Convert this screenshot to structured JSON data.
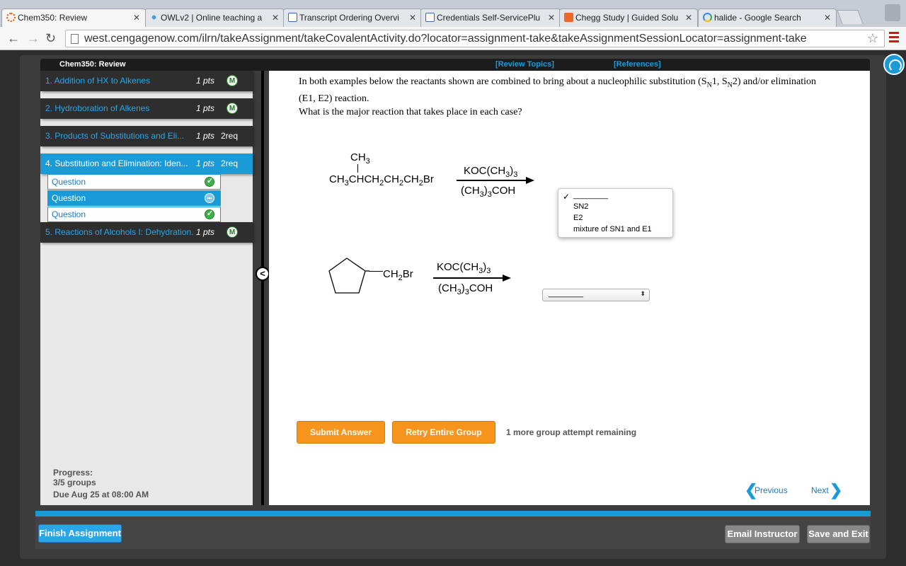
{
  "browser": {
    "tabs": [
      {
        "title": "Chem350: Review",
        "favicon": "dotted-circle-icon"
      },
      {
        "title": "OWLv2 | Online teaching a",
        "favicon": "owl-icon"
      },
      {
        "title": "Transcript Ordering Overvi",
        "favicon": "book-icon"
      },
      {
        "title": "Credentials Self-ServicePlu",
        "favicon": "book-icon"
      },
      {
        "title": "Chegg Study | Guided Solu",
        "favicon": "chegg-icon"
      },
      {
        "title": "halide - Google Search",
        "favicon": "google-icon"
      }
    ],
    "url": "west.cengagenow.com/ilrn/takeAssignment/takeCovalentActivity.do?locator=assignment-take&takeAssignmentSessionLocator=assignment-take"
  },
  "header": {
    "course": "Chem350: Review",
    "review_topics": "[Review Topics]",
    "references": "[References]"
  },
  "sidebar": {
    "items": [
      {
        "label": "1. Addition of HX to Alkenes",
        "pts": "1 pts",
        "badge": "M"
      },
      {
        "label": "2. Hydroboration of Alkenes",
        "pts": "1 pts",
        "badge": "M"
      },
      {
        "label": "3. Products of Substitutions and Eli...",
        "pts": "1 pts",
        "badge": "2req"
      },
      {
        "label": "4. Substitution and Elimination: Iden...",
        "pts": "1 pts",
        "badge": "2req"
      },
      {
        "label": "5. Reactions of Alcohols I: Dehydration..",
        "pts": "1 pts",
        "badge": "M"
      }
    ],
    "subitems": [
      {
        "label": "Question",
        "status": "complete"
      },
      {
        "label": "Question",
        "status": "current"
      },
      {
        "label": "Question",
        "status": "complete"
      }
    ],
    "progress_label": "Progress:",
    "progress_value": "3/5 groups",
    "due": "Due Aug 25 at 08:00 AM"
  },
  "question": {
    "text_1": "In both examples below the reactants shown are combined to bring about a nucleophilic substitution (S",
    "sub_n": "N",
    "text_2": "1, S",
    "text_3": "2) and/or elimination (E1, E2) reaction.",
    "text_4": "What is the major reaction that takes place in each case?"
  },
  "reaction1": {
    "methyl": "CH",
    "methyl_sub": "3",
    "reagent": "KOC(CH",
    "reagent_sub": "3",
    "reagent_close": ")",
    "reagent_sub2": "3",
    "solvent_open": "(CH",
    "solvent_sub": "3",
    "solvent_close": ")",
    "solvent_sub2": "3",
    "solvent_tail": "COH"
  },
  "reaction2": {
    "group": "CH",
    "group_sub": "2",
    "group_tail": "Br"
  },
  "dropdown": {
    "options": [
      "________",
      "SN2",
      "E2",
      "mixture of SN1 and E1"
    ],
    "selected": "________",
    "check": "✓"
  },
  "select2": {
    "value": "________",
    "arrow": "⬍"
  },
  "buttons": {
    "submit": "Submit Answer",
    "retry": "Retry Entire Group",
    "attempts": "1 more group attempt remaining",
    "previous": "Previous",
    "next": "Next",
    "finish": "Finish Assignment",
    "email": "Email Instructor",
    "save_exit": "Save and Exit"
  },
  "colors": {
    "accent": "#1a9bd7",
    "orange": "#f7941d",
    "dark": "#2e2e2e"
  }
}
